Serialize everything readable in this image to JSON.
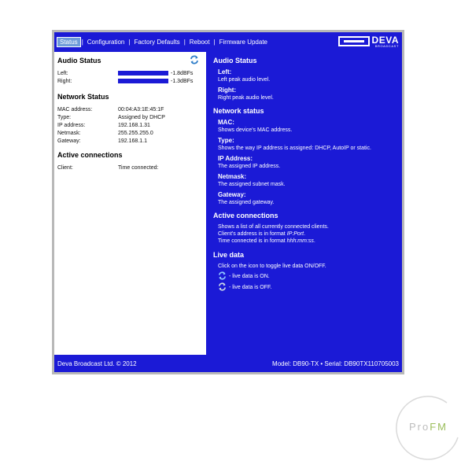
{
  "nav": {
    "items": [
      {
        "label": "Status",
        "active": true
      },
      {
        "label": "Configuration",
        "active": false
      },
      {
        "label": "Factory Defaults",
        "active": false
      },
      {
        "label": "Reboot",
        "active": false
      },
      {
        "label": "Firmware Update",
        "active": false
      }
    ],
    "separator": "|"
  },
  "logo": {
    "name": "DEVA",
    "sub": "BROADCAST"
  },
  "left": {
    "audio_title": "Audio Status",
    "left_label": "Left:",
    "left_value": "-1.8dBFs",
    "left_level": 0.8,
    "right_label": "Right:",
    "right_value": "-1.3dBFs",
    "right_level": 0.82,
    "network_title": "Network Status",
    "network_rows": [
      {
        "key": "MAC address:",
        "value": "00:04:A3:1E:45:1F"
      },
      {
        "key": "Type:",
        "value": "Assigned by DHCP"
      },
      {
        "key": "IP address:",
        "value": "192.168.1.31"
      },
      {
        "key": "Netmask:",
        "value": "255.255.255.0"
      },
      {
        "key": "Gateway:",
        "value": "192.168.1.1"
      }
    ],
    "connections_title": "Active connections",
    "client_label": "Client:",
    "client_value": "Time connected:"
  },
  "right": {
    "audio_title": "Audio Status",
    "audio_items": [
      {
        "head": "Left:",
        "text": "Left peak audio level."
      },
      {
        "head": "Right:",
        "text": "Right peak audio level."
      }
    ],
    "network_title": "Network status",
    "network_items": [
      {
        "head": "MAC:",
        "text": "Shows device's MAC address."
      },
      {
        "head": "Type:",
        "text": "Shows the way IP address is assigned: DHCP, AutoIP or static."
      },
      {
        "head": "IP Address:",
        "text": "The assigned IP address."
      },
      {
        "head": "Netmask:",
        "text": "The assigned subnet mask."
      },
      {
        "head": "Gateway:",
        "text": "The assigned gateway."
      }
    ],
    "connections_title": "Active connections",
    "conn_line1": "Shows a list of all currently connected clients.",
    "conn_line2_pre": "Client's address is in format ",
    "conn_line2_fmt": "IP:Port",
    "conn_line2_post": ".",
    "conn_line3_pre": "Time connected is in format ",
    "conn_line3_fmt": "hhh:mm:ss",
    "conn_line3_post": ".",
    "live_title": "Live data",
    "live_text": "Click on the icon to toggle live data ON/OFF.",
    "live_on": "- live data is ON.",
    "live_off": "- live data is OFF."
  },
  "footer": {
    "left": "Deva Broadcast Ltd. © 2012",
    "right": "Model: DB90-TX • Serial: DB90TX110705003"
  },
  "watermark": {
    "p": "P",
    "ro": "ro",
    "fm": "FM"
  },
  "colors": {
    "panel": "#1b1ad6",
    "frame": "#b8b8b8",
    "active_tab": "#6e9bd9",
    "icon_on": "#2f7ec9",
    "icon_off": "#8fa9c9"
  }
}
